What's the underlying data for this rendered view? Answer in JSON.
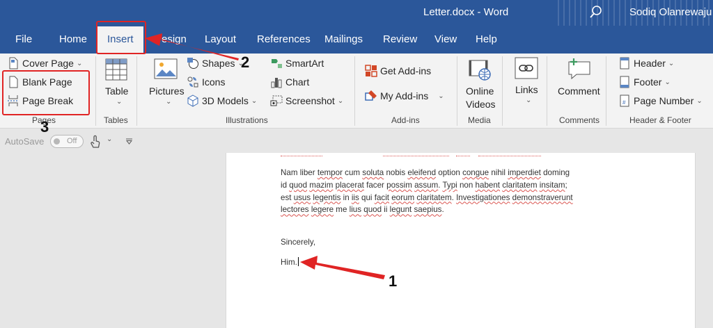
{
  "window": {
    "title": "Letter.docx  -  Word",
    "user": "Sodiq Olanrewaju"
  },
  "tabs": [
    {
      "label": "File"
    },
    {
      "label": "Home"
    },
    {
      "label": "Insert"
    },
    {
      "label": "esign"
    },
    {
      "label": "Layout"
    },
    {
      "label": "References"
    },
    {
      "label": "Mailings"
    },
    {
      "label": "Review"
    },
    {
      "label": "View"
    },
    {
      "label": "Help"
    }
  ],
  "ribbon": {
    "pages": {
      "cover_page": "Cover Page",
      "blank_page": "Blank Page",
      "page_break": "Page Break",
      "group": "Pages"
    },
    "tables": {
      "table": "Table",
      "group": "Tables"
    },
    "illustrations": {
      "pictures": "Pictures",
      "shapes": "Shapes",
      "icons": "Icons",
      "models": "3D Models",
      "smartart": "SmartArt",
      "chart": "Chart",
      "screenshot": "Screenshot",
      "group": "Illustrations"
    },
    "addins": {
      "get": "Get Add-ins",
      "my": "My Add-ins",
      "group": "Add-ins"
    },
    "media": {
      "online_videos_1": "Online",
      "online_videos_2": "Videos",
      "group": "Media"
    },
    "links": {
      "label": "Links"
    },
    "comments": {
      "label": "Comment",
      "group": "Comments"
    },
    "header_footer": {
      "header": "Header",
      "footer": "Footer",
      "page_number": "Page Number",
      "group": "Header & Footer"
    }
  },
  "qat": {
    "autosave": "AutoSave",
    "toggle": "Off"
  },
  "document": {
    "paragraph": [
      {
        "t": "Nam liber ",
        "e": false
      },
      {
        "t": "tempor",
        "e": true
      },
      {
        "t": " cum ",
        "e": false
      },
      {
        "t": "soluta",
        "e": true
      },
      {
        "t": " nobis ",
        "e": false
      },
      {
        "t": "eleifend",
        "e": true
      },
      {
        "t": " option ",
        "e": false
      },
      {
        "t": "congue",
        "e": true
      },
      {
        "t": " nihil ",
        "e": false
      },
      {
        "t": "imperdiet",
        "e": true
      },
      {
        "t": " doming id ",
        "e": false
      },
      {
        "t": "quod",
        "e": true
      },
      {
        "t": " ",
        "e": false
      },
      {
        "t": "mazim",
        "e": true
      },
      {
        "t": " ",
        "e": false
      },
      {
        "t": "placerat",
        "e": true
      },
      {
        "t": " facer ",
        "e": false
      },
      {
        "t": "possim",
        "e": true
      },
      {
        "t": " ",
        "e": false
      },
      {
        "t": "assum",
        "e": true
      },
      {
        "t": ". ",
        "e": false
      },
      {
        "t": "Typi",
        "e": true
      },
      {
        "t": " non ",
        "e": false
      },
      {
        "t": "habent",
        "e": true
      },
      {
        "t": " ",
        "e": false
      },
      {
        "t": "claritatem",
        "e": true
      },
      {
        "t": " ",
        "e": false
      },
      {
        "t": "insitam",
        "e": true
      },
      {
        "t": "; est ",
        "e": false
      },
      {
        "t": "usus",
        "e": true
      },
      {
        "t": " ",
        "e": false
      },
      {
        "t": "legentis",
        "e": true
      },
      {
        "t": " in ",
        "e": false
      },
      {
        "t": "iis",
        "e": true
      },
      {
        "t": " qui ",
        "e": false
      },
      {
        "t": "facit",
        "e": true
      },
      {
        "t": " ",
        "e": false
      },
      {
        "t": "eorum",
        "e": true
      },
      {
        "t": " ",
        "e": false
      },
      {
        "t": "claritatem",
        "e": true
      },
      {
        "t": ". ",
        "e": false
      },
      {
        "t": "Investigationes",
        "e": true
      },
      {
        "t": " ",
        "e": false
      },
      {
        "t": "demonstraverunt",
        "e": true
      },
      {
        "t": " ",
        "e": false
      },
      {
        "t": "lectores",
        "e": true
      },
      {
        "t": " ",
        "e": false
      },
      {
        "t": "legere",
        "e": true
      },
      {
        "t": " me ",
        "e": false
      },
      {
        "t": "lius",
        "e": true
      },
      {
        "t": " ",
        "e": false
      },
      {
        "t": "quod",
        "e": true
      },
      {
        "t": " ii ",
        "e": false
      },
      {
        "t": "legunt",
        "e": true
      },
      {
        "t": " ",
        "e": false
      },
      {
        "t": "saepius",
        "e": true
      },
      {
        "t": ".",
        "e": false
      }
    ],
    "closing": "Sincerely,",
    "signature": "Him."
  },
  "annotations": {
    "n1": "1",
    "n2": "2",
    "n3": "3"
  },
  "colors": {
    "word_blue": "#2b579a",
    "annotation_red": "#e02424"
  }
}
